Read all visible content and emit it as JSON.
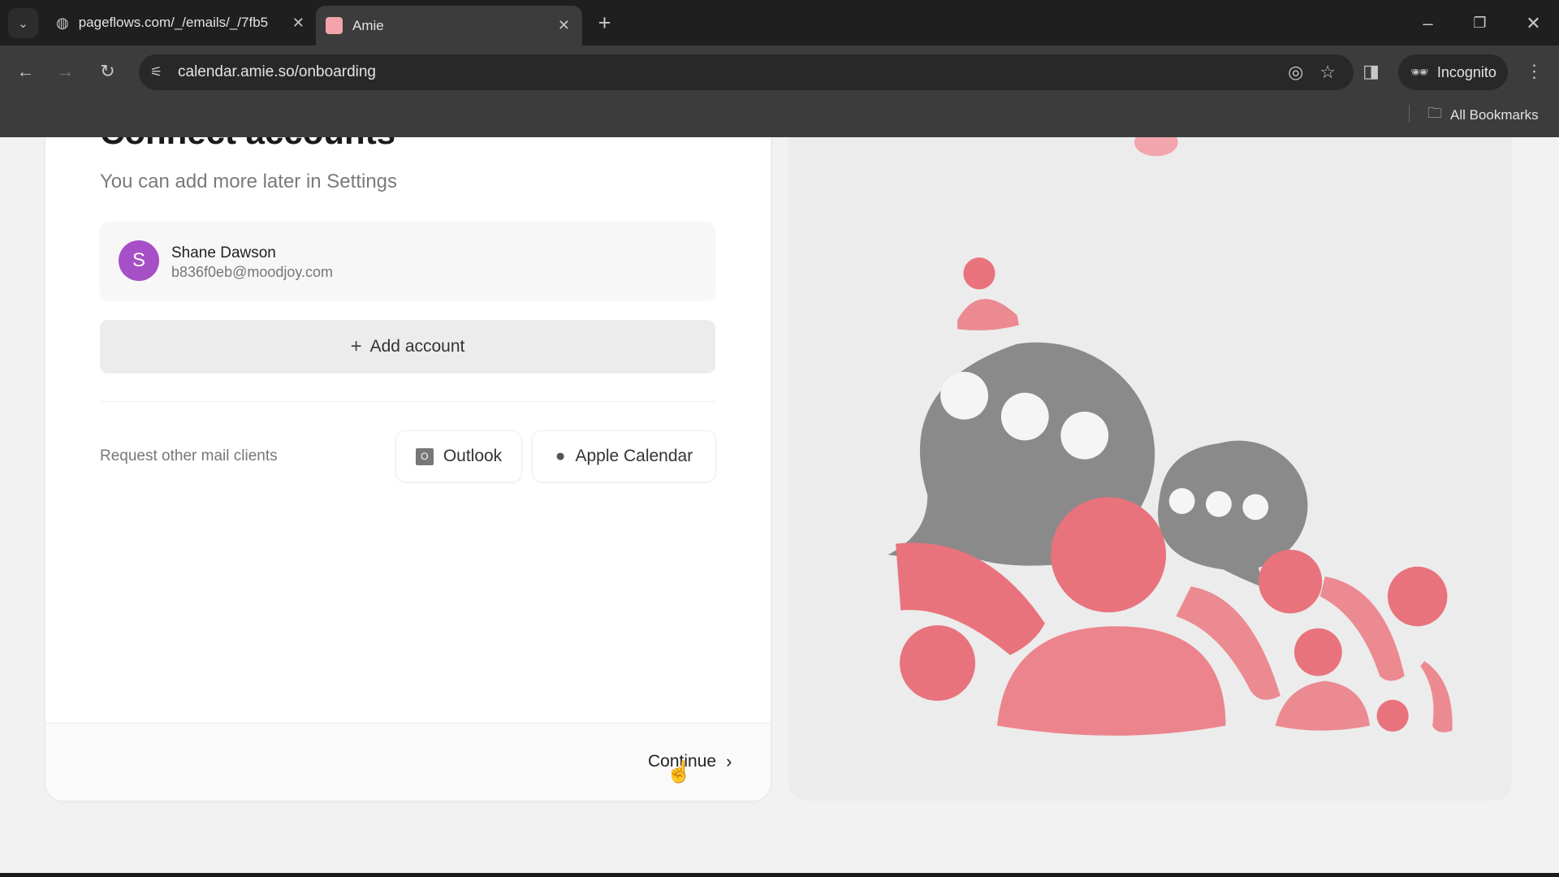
{
  "browser": {
    "tabs": [
      {
        "label": "pageflows.com/_/emails/_/7fb5",
        "icon": "globe-icon",
        "active": false
      },
      {
        "label": "Amie",
        "icon": "amie-favicon",
        "active": true
      }
    ],
    "url": "calendar.amie.so/onboarding",
    "incognito_label": "Incognito",
    "bookmarks_label": "All Bookmarks"
  },
  "page": {
    "title": "Connect accounts",
    "subtitle": "You can add more later in Settings",
    "account": {
      "initial": "S",
      "name": "Shane Dawson",
      "email": "b836f0eb@moodjoy.com",
      "avatar_color": "#a64fc7"
    },
    "add_account_label": "Add account",
    "request_label": "Request other mail clients",
    "clients": [
      {
        "label": "Outlook",
        "icon": "outlook-icon"
      },
      {
        "label": "Apple Calendar",
        "icon": "apple-icon"
      }
    ],
    "continue_label": "Continue"
  },
  "colors": {
    "accent_pink": "#e8737d",
    "bubble_gray": "#8a8a8a"
  }
}
